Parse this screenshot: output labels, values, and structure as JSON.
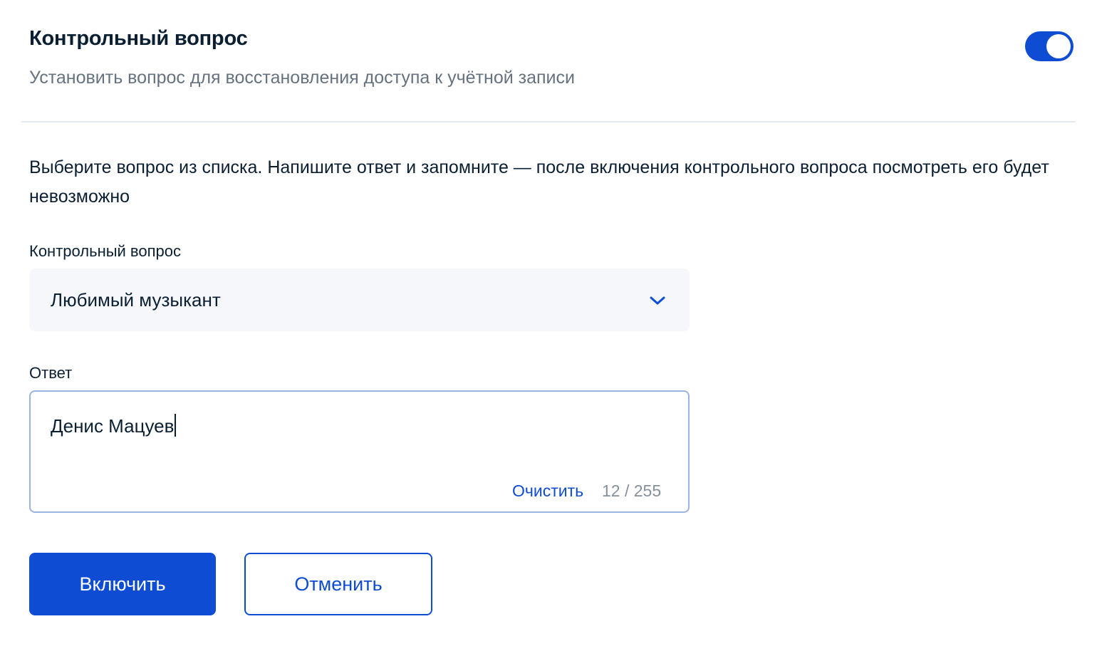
{
  "header": {
    "title": "Контрольный вопрос",
    "subtitle": "Установить вопрос для восстановления доступа к учётной записи",
    "toggle_enabled": true
  },
  "instruction": "Выберите вопрос из списка. Напишите ответ и запомните — после включения контрольного вопроса посмотреть его будет невозможно",
  "question_field": {
    "label": "Контрольный вопрос",
    "selected_value": "Любимый музыкант"
  },
  "answer_field": {
    "label": "Ответ",
    "value": "Денис Мацуев",
    "clear_label": "Очистить",
    "counter": "12 / 255"
  },
  "actions": {
    "enable_label": "Включить",
    "cancel_label": "Отменить"
  },
  "colors": {
    "accent": "#0d4cd3",
    "text": "#0b1f33",
    "muted_text": "#66727f",
    "field_background": "#f5f7fa",
    "focus_border": "#9bb2e4"
  },
  "icons": {
    "select_chevron": "chevron-down-icon"
  }
}
